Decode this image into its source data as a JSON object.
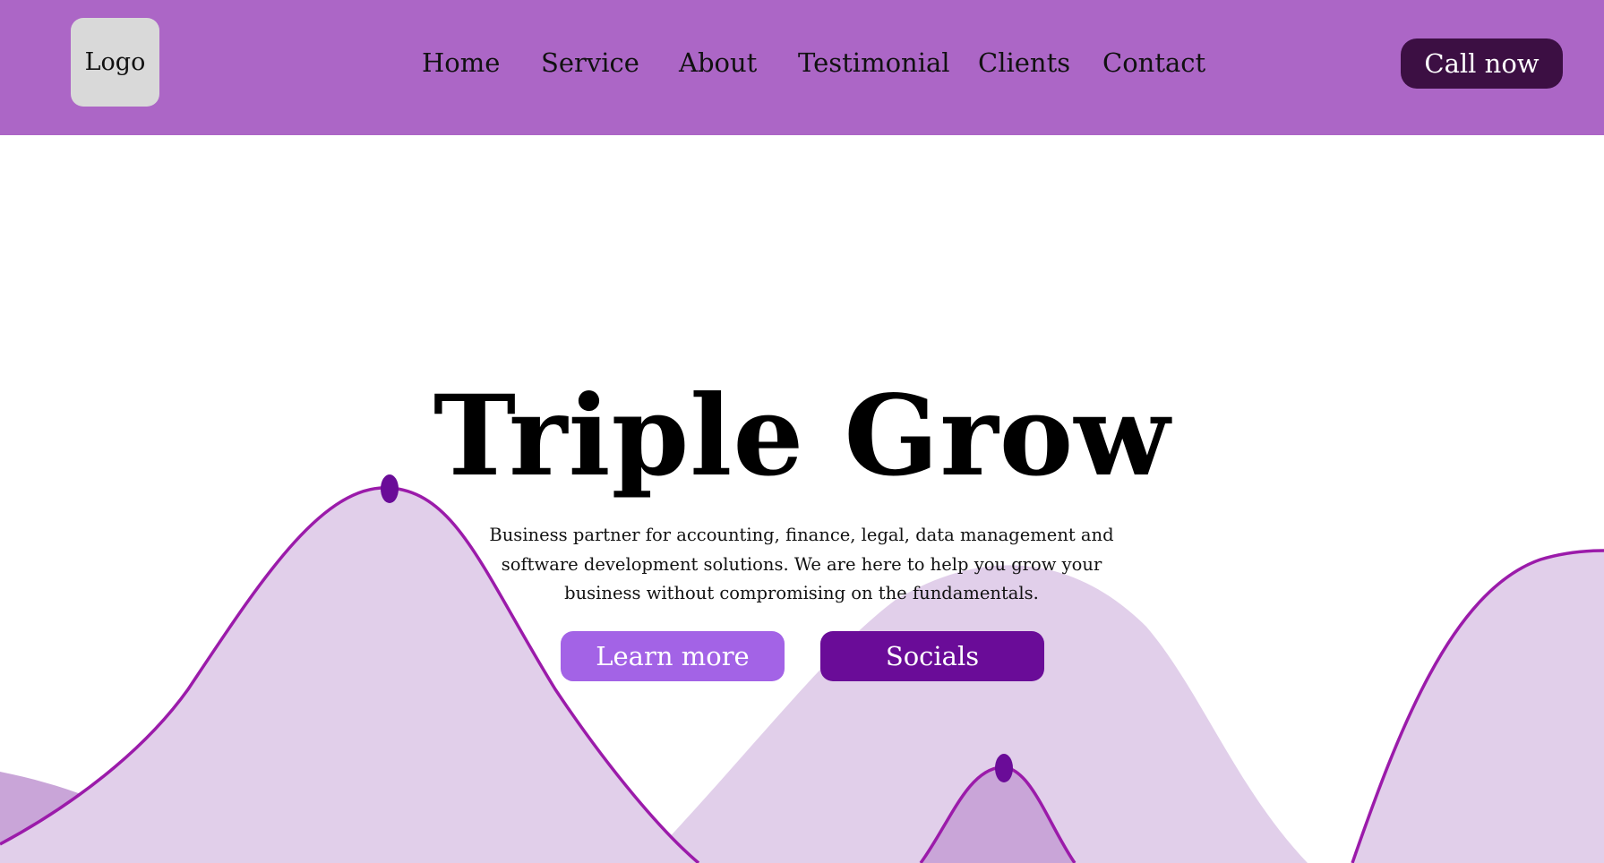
{
  "header": {
    "logo_text": "Logo",
    "nav": [
      "Home",
      "Service",
      "About",
      "Testimonial",
      "Clients",
      "Contact"
    ],
    "cta_label": "Call now"
  },
  "hero": {
    "title": "Triple Grow",
    "description": "Business partner for accounting, finance, legal, data management and software development solutions. We are here to help you grow your business without compromising on the fundamentals.",
    "primary_button": "Learn more",
    "secondary_button": "Socials"
  },
  "colors": {
    "header_bg": "#AC66C6",
    "logo_bg": "#D9D9D9",
    "call_btn_bg": "#3C0F43",
    "learn_btn_bg": "#A363E6",
    "socials_btn_bg": "#6A0C98",
    "wave_light": "#E1CFEA",
    "wave_mid": "#C9A5D8",
    "wave_stroke": "#9B1BAA",
    "peak_marker": "#6A0C98"
  }
}
